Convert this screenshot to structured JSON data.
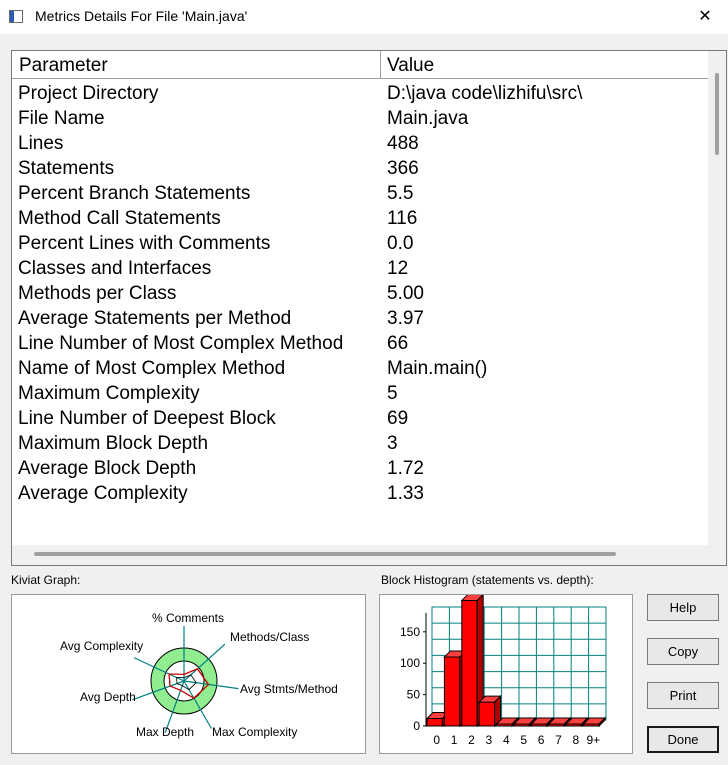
{
  "window": {
    "title": "Metrics Details For File 'Main.java'",
    "close_glyph": "✕"
  },
  "table": {
    "headers": [
      "Parameter",
      "Value"
    ],
    "rows": [
      [
        "Project Directory",
        "D:\\java code\\lizhifu\\src\\"
      ],
      [
        "File Name",
        "Main.java"
      ],
      [
        "Lines",
        "488"
      ],
      [
        "Statements",
        "366"
      ],
      [
        "Percent Branch Statements",
        "5.5"
      ],
      [
        "Method Call Statements",
        "116"
      ],
      [
        "Percent Lines with Comments",
        "0.0"
      ],
      [
        "Classes and Interfaces",
        "12"
      ],
      [
        "Methods per Class",
        "5.00"
      ],
      [
        "Average Statements per Method",
        "3.97"
      ],
      [
        "Line Number of Most Complex Method",
        "66"
      ],
      [
        "Name of Most Complex Method",
        "Main.main()"
      ],
      [
        "Maximum Complexity",
        "5"
      ],
      [
        "Line Number of Deepest Block",
        "69"
      ],
      [
        "Maximum Block Depth",
        "3"
      ],
      [
        "Average Block Depth",
        "1.72"
      ],
      [
        "Average Complexity",
        "1.33"
      ]
    ]
  },
  "kiviat": {
    "label": "Kiviat Graph:",
    "axes": [
      "% Comments",
      "Methods/Class",
      "Avg Stmts/Method",
      "Max Complexity",
      "Max Depth",
      "Avg Depth",
      "Avg Complexity"
    ],
    "ring_color": "#90ee90"
  },
  "histogram": {
    "label": "Block Histogram (statements vs. depth):",
    "bar_color": "#ff0000",
    "grid_color": "#008080"
  },
  "chart_data": {
    "type": "bar",
    "categories": [
      "0",
      "1",
      "2",
      "3",
      "4",
      "5",
      "6",
      "7",
      "8",
      "9+"
    ],
    "values": [
      12,
      110,
      200,
      38,
      0,
      0,
      0,
      0,
      0,
      0
    ],
    "y_ticks": [
      "0",
      "50",
      "100",
      "150"
    ],
    "ylim": [
      0,
      180
    ]
  },
  "buttons": {
    "help": "Help",
    "copy": "Copy",
    "print": "Print",
    "done": "Done"
  }
}
